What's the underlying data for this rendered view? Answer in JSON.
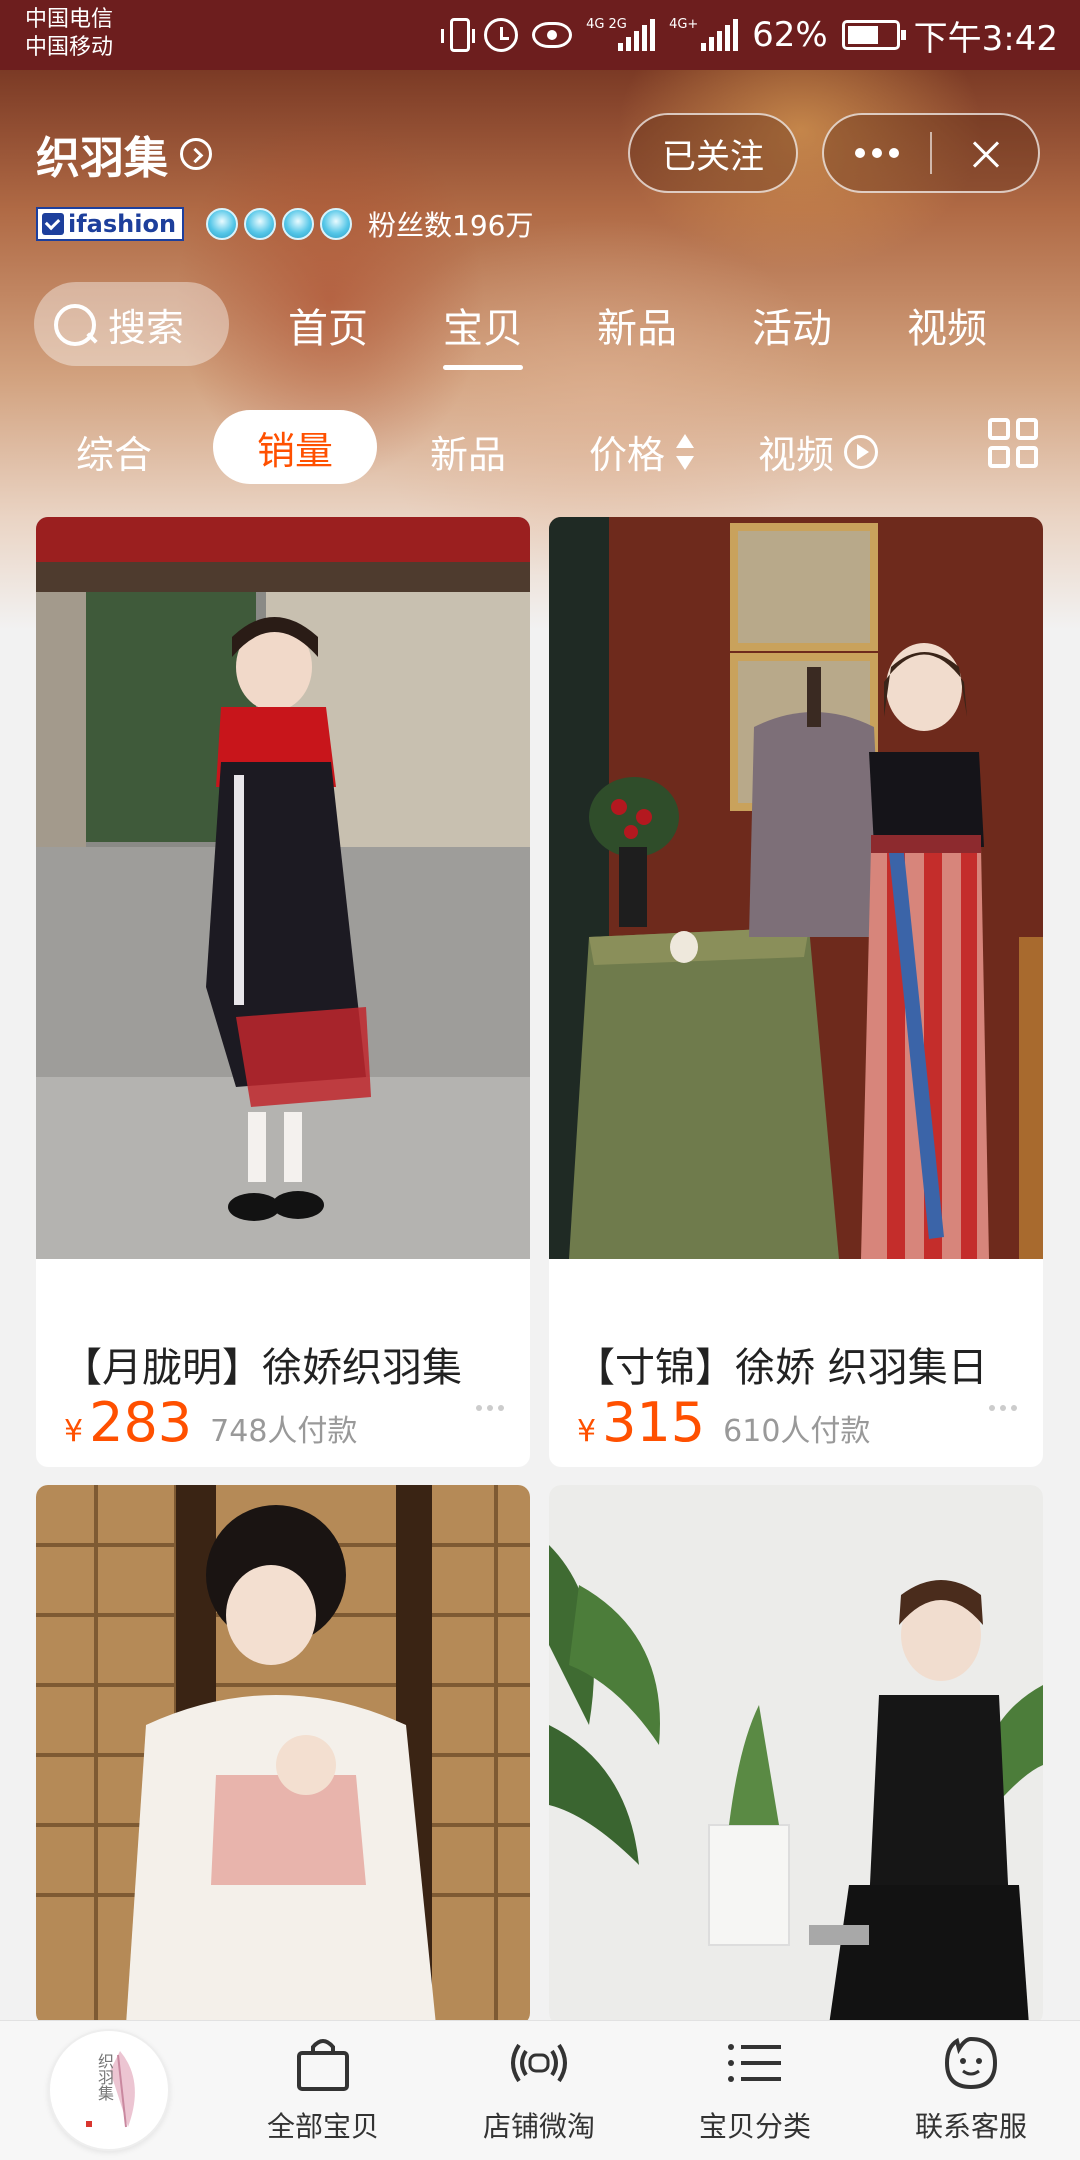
{
  "status_bar": {
    "carrier_1": "中国电信",
    "carrier_2": "中国移动",
    "network_1": "4G 2G",
    "network_2": "4G+",
    "battery": "62%",
    "time": "下午3:42"
  },
  "shop": {
    "name": "织羽集",
    "follow_label": "已关注",
    "badge": "ifashion",
    "fans": "粉丝数196万"
  },
  "nav": {
    "search_label": "搜索",
    "tabs": [
      "首页",
      "宝贝",
      "新品",
      "活动",
      "视频"
    ],
    "active_tab": "宝贝"
  },
  "sort": {
    "options": [
      "综合",
      "销量",
      "新品",
      "价格",
      "视频"
    ],
    "active": "销量"
  },
  "products": [
    {
      "title": "【月胧明】徐娇织羽集",
      "currency": "¥",
      "price": "283",
      "sold": "748人付款"
    },
    {
      "title": "【寸锦】徐娇 织羽集日",
      "currency": "¥",
      "price": "315",
      "sold": "610人付款"
    }
  ],
  "bottom_bar": {
    "logo_text": "织羽集",
    "items": [
      "全部宝贝",
      "店铺微淘",
      "宝贝分类",
      "联系客服"
    ]
  },
  "colors": {
    "accent": "#ff5000",
    "status_bar": "#6d1e1e"
  }
}
